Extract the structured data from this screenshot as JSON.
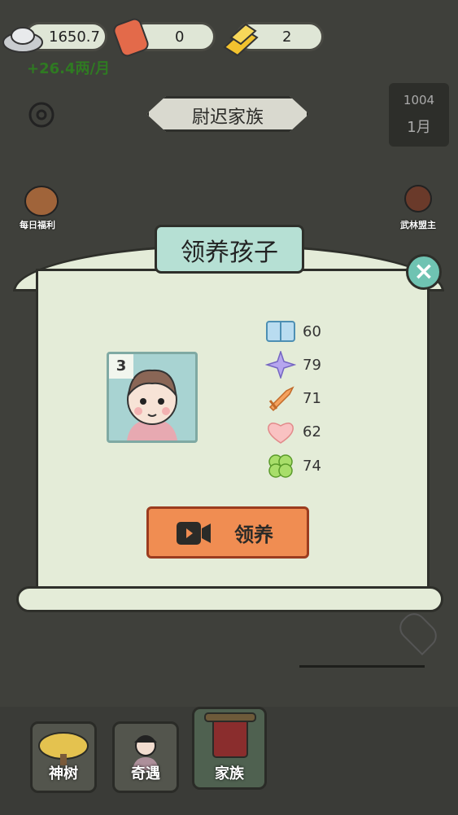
{
  "resources": {
    "silver": "1650.7",
    "token": "0",
    "gold": "2",
    "income": "+26.4两/月"
  },
  "header": {
    "family_name": "尉迟家族",
    "year": "1004",
    "month": "1月"
  },
  "side": {
    "daily_welfare": "每日福利",
    "martial_leader": "武林盟主"
  },
  "dialog": {
    "title": "领养孩子",
    "child_number": "3",
    "stats": [
      {
        "icon": "book-icon",
        "value": "60"
      },
      {
        "icon": "sparkle-icon",
        "value": "79"
      },
      {
        "icon": "sword-icon",
        "value": "71"
      },
      {
        "icon": "heart-icon",
        "value": "62"
      },
      {
        "icon": "clover-icon",
        "value": "74"
      }
    ],
    "adopt_label": "领养"
  },
  "bottom_nav": {
    "tabs": [
      {
        "label": "神树"
      },
      {
        "label": "奇遇"
      },
      {
        "label": "家族"
      }
    ]
  }
}
